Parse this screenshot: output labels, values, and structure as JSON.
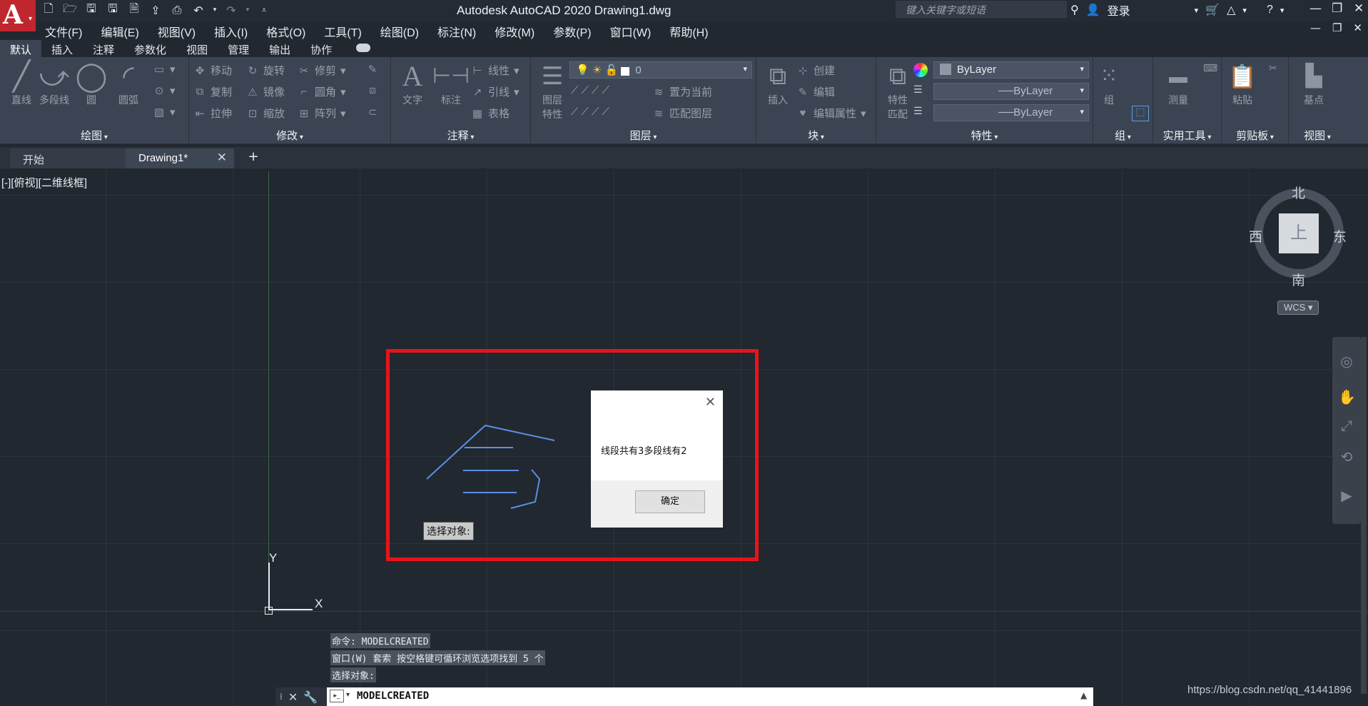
{
  "app": {
    "logo_letter": "A",
    "title": "Autodesk AutoCAD 2020    Drawing1.dwg",
    "search_placeholder": "键入关键字或短语",
    "login": "登录"
  },
  "menu": [
    "文件(F)",
    "编辑(E)",
    "视图(V)",
    "插入(I)",
    "格式(O)",
    "工具(T)",
    "绘图(D)",
    "标注(N)",
    "修改(M)",
    "参数(P)",
    "窗口(W)",
    "帮助(H)"
  ],
  "ribbon_tabs": [
    "默认",
    "插入",
    "注释",
    "参数化",
    "视图",
    "管理",
    "输出",
    "协作"
  ],
  "ribbon": {
    "draw": {
      "title": "绘图",
      "line": "直线",
      "polyline": "多段线",
      "circle": "圆",
      "arc": "圆弧"
    },
    "modify": {
      "title": "修改",
      "move": "移动",
      "rotate": "旋转",
      "trim": "修剪",
      "copy": "复制",
      "mirror": "镜像",
      "fillet": "圆角",
      "stretch": "拉伸",
      "scale": "缩放",
      "array": "阵列"
    },
    "annotation": {
      "title": "注释",
      "text": "文字",
      "dimension": "标注",
      "linear": "线性",
      "leader": "引线",
      "table": "表格"
    },
    "layers": {
      "title": "图层",
      "layer_props": "图层\n特性",
      "layer_props_l1": "图层",
      "layer_props_l2": "特性",
      "current_layer": "0",
      "make_current": "置为当前",
      "match_layer": "匹配图层"
    },
    "block": {
      "title": "块",
      "insert": "插入",
      "create": "创建",
      "edit": "编辑",
      "edit_attr": "编辑属性"
    },
    "properties": {
      "title": "特性",
      "match_l1": "特性",
      "match_l2": "匹配",
      "color": "ByLayer",
      "linetype": "ByLayer",
      "lineweight": "ByLayer"
    },
    "groups": {
      "title": "组",
      "group": "组"
    },
    "utilities": {
      "title": "实用工具",
      "measure": "测量"
    },
    "clipboard": {
      "title": "剪贴板",
      "paste": "粘贴"
    },
    "view": {
      "title": "视图",
      "base": "基点"
    }
  },
  "file_tabs": {
    "start": "开始",
    "active": "Drawing1*"
  },
  "viewport_label": "[-][俯视][二维线框]",
  "viewcube": {
    "north": "北",
    "south": "南",
    "east": "东",
    "west": "西",
    "face": "上",
    "wcs": "WCS ▾"
  },
  "dialog": {
    "message": "线段共有3多段线有2",
    "ok": "确定"
  },
  "select_tooltip": "选择对象:",
  "ucs": {
    "x": "X",
    "y": "Y"
  },
  "command_history": [
    "命令: MODELCREATED",
    "窗口(W) 套索  按空格键可循环浏览选项找到 5 个",
    "选择对象:"
  ],
  "command_input": "MODELCREATED",
  "watermark": "https://blog.csdn.net/qq_41441896",
  "colors": {
    "highlight": "#e8131a",
    "drawing_lines": "#5b8fe8",
    "background": "#212830"
  }
}
